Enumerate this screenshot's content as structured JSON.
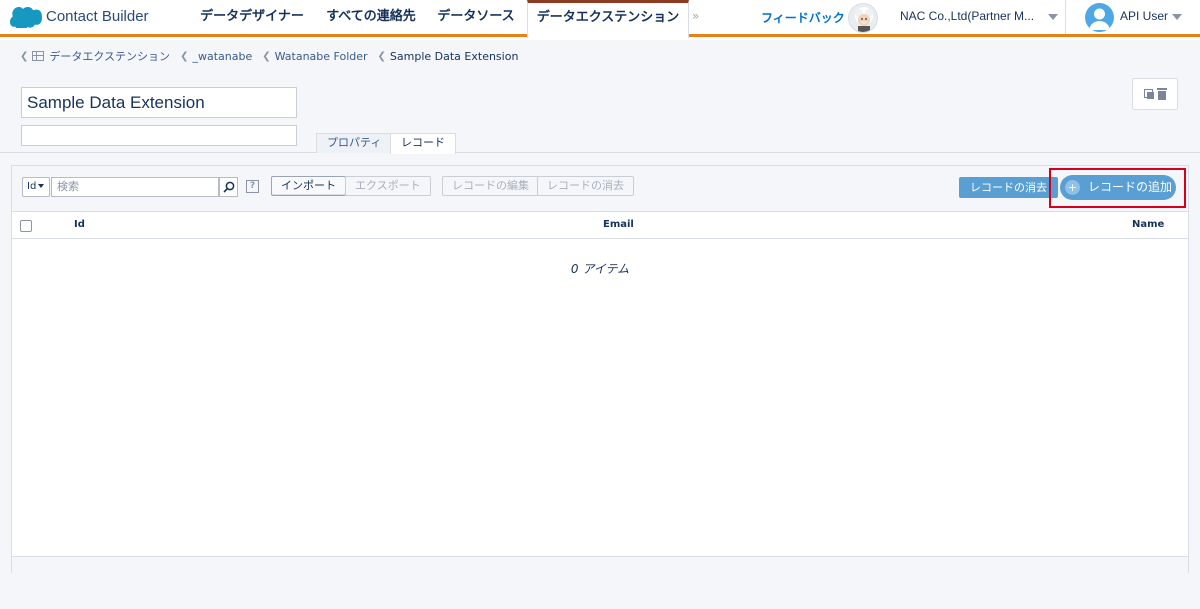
{
  "header": {
    "app_name": "Contact Builder",
    "nav": [
      {
        "label": "データデザイナー",
        "active": false
      },
      {
        "label": "すべての連絡先",
        "active": false
      },
      {
        "label": "データソース",
        "active": false
      },
      {
        "label": "データエクステンション",
        "active": true
      }
    ],
    "more_glyph": "»",
    "feedback": "フィードバック",
    "org": "NAC Co.,Ltd(Partner M...",
    "user": "API User",
    "accent_color": "#e8811a"
  },
  "breadcrumb": [
    {
      "label": "データエクステンション"
    },
    {
      "label": "_watanabe"
    },
    {
      "label": "Watanabe Folder"
    },
    {
      "label": "Sample Data Extension"
    }
  ],
  "extension": {
    "name": "Sample Data Extension",
    "description": ""
  },
  "subtabs": [
    {
      "label": "プロパティ",
      "active": false
    },
    {
      "label": "レコード",
      "active": true
    }
  ],
  "toolbar": {
    "field_select": "Id",
    "search_placeholder": "検索",
    "help": "?",
    "import": "インポート",
    "export": "エクスポート",
    "edit_records": "レコードの編集",
    "delete_records": "レコードの消去",
    "clear_records": "レコードの消去",
    "add_record": "レコードの追加",
    "add_icon": "+"
  },
  "table": {
    "columns": [
      "Id",
      "Email",
      "Name"
    ],
    "rows": [],
    "empty_message": "0 アイテム"
  }
}
